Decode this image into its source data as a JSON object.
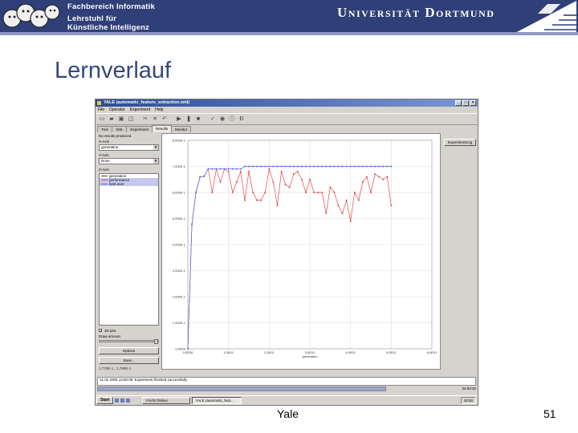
{
  "header": {
    "dept_lines": [
      "Fachbereich Informatik",
      "Lehrstuhl für",
      "Künstliche Intelligenz"
    ],
    "university": "Universität Dortmund"
  },
  "slide": {
    "title": "Lernverlauf",
    "footer_center": "Yale",
    "page_number": "51"
  },
  "window": {
    "title": "YALE (automatic_feature_extraction.xml)",
    "controls": [
      "_",
      "□",
      "×"
    ],
    "menu": [
      "File",
      "Operator",
      "Experiment",
      "Help"
    ],
    "toolbar_icons": [
      "new-icon",
      "open-icon",
      "save-icon",
      "save-as-icon",
      "cut-icon",
      "delete-icon",
      "undo-icon",
      "run-icon",
      "pause-icon",
      "stop-icon",
      "validate-icon",
      "view-icon",
      "info-icon",
      "breakpoint-icon"
    ],
    "tabs": [
      "Tree",
      "XML",
      "Experiment",
      "Results",
      "Monitor"
    ],
    "active_tab": "Results",
    "left_panel": {
      "status": "No results produced.",
      "x_axis_label": "X-Axis",
      "x_axis_value": "generation",
      "y_axis_label": "Y-Axis",
      "y_axis_value": "None",
      "z_axis_label": "Z-Axis",
      "z_items": [
        "generation",
        "performance",
        "best ever"
      ],
      "z_selected": [
        "performance",
        "best ever"
      ],
      "plot3d_label": "3D plot",
      "plot3d_checked": true,
      "draw_amount_label": "Draw amount",
      "options_button": "Options",
      "save_button": "Save...",
      "coords": "1,775E-1 ; 1,790E-1"
    },
    "right_panel": {
      "button": "ExperimentLog"
    },
    "log_text": "21.02.2005 13:50:08: Experiment finished successfully",
    "status_time": "34:00:20",
    "taskbar": {
      "start": "Start",
      "tasks": [
        "YAVIS Diskus",
        "YALE (automatic_feat..."
      ],
      "active_task": 1,
      "clock": "10:00"
    }
  },
  "chart_data": {
    "type": "line",
    "xlabel": "generation",
    "ylabel": "",
    "xlim": [
      0,
      60
    ],
    "ylim": [
      0,
      0.8
    ],
    "x_ticks": [
      0,
      10,
      20,
      30,
      40,
      50,
      60
    ],
    "x_tick_labels": [
      "0,0E00",
      "1,0E01",
      "2,0E01",
      "3,0E01",
      "4,0E01",
      "5,0E01",
      "6,0E01"
    ],
    "y_ticks": [
      0,
      0.1,
      0.2,
      0.3,
      0.4,
      0.5,
      0.6,
      0.7,
      0.8
    ],
    "y_tick_labels": [
      "0,0E00",
      "1,000E-1",
      "2,000E-1",
      "3,000E-1",
      "4,000E-1",
      "5,000E-1",
      "6,000E-1",
      "7,000E-1",
      "8,000E-1"
    ],
    "grid": true,
    "legend": "none",
    "x": [
      0,
      1,
      2,
      3,
      4,
      5,
      6,
      7,
      8,
      9,
      10,
      11,
      12,
      13,
      14,
      15,
      16,
      17,
      18,
      19,
      20,
      21,
      22,
      23,
      24,
      25,
      26,
      27,
      28,
      29,
      30,
      31,
      32,
      33,
      34,
      35,
      36,
      37,
      38,
      39,
      40,
      41,
      42,
      43,
      44,
      45,
      46,
      47,
      48,
      49,
      50
    ],
    "series": [
      {
        "color": "#5b67e0",
        "values": [
          0,
          0.478,
          0.6,
          0.66,
          0.662,
          0.69,
          0.69,
          0.69,
          0.69,
          0.69,
          0.69,
          0.69,
          0.69,
          0.69,
          0.7,
          0.7,
          0.7,
          0.7,
          0.7,
          0.7,
          0.7,
          0.7,
          0.7,
          0.7,
          0.7,
          0.7,
          0.7,
          0.7,
          0.7,
          0.7,
          0.7,
          0.7,
          0.7,
          0.7,
          0.7,
          0.7,
          0.7,
          0.7,
          0.7,
          0.7,
          0.7,
          0.7,
          0.7,
          0.7,
          0.7,
          0.7,
          0.7,
          0.7,
          0.7,
          0.7,
          0.7
        ]
      },
      {
        "color": "#e04848",
        "values": [
          0,
          0.478,
          0.6,
          0.66,
          0.662,
          0.69,
          0.6,
          0.69,
          0.64,
          0.69,
          0.68,
          0.6,
          0.64,
          0.68,
          0.57,
          0.68,
          0.6,
          0.57,
          0.57,
          0.6,
          0.69,
          0.64,
          0.55,
          0.68,
          0.63,
          0.62,
          0.67,
          0.68,
          0.65,
          0.6,
          0.65,
          0.6,
          0.6,
          0.6,
          0.52,
          0.62,
          0.6,
          0.55,
          0.52,
          0.57,
          0.49,
          0.6,
          0.57,
          0.64,
          0.66,
          0.6,
          0.67,
          0.66,
          0.65,
          0.66,
          0.55
        ]
      }
    ]
  }
}
